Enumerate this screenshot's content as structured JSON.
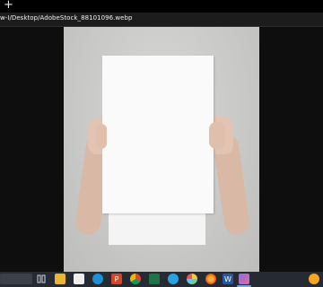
{
  "browser": {
    "new_tab_glyph": "+",
    "address": "w-I/Desktop/AdobeStock_88101096.webp"
  },
  "viewer": {
    "image_subject": "person holding blank white sheet of paper in front of face"
  },
  "taskbar": {
    "icons": [
      {
        "name": "task-view-icon"
      },
      {
        "name": "file-explorer-icon"
      },
      {
        "name": "calendar-app-icon"
      },
      {
        "name": "edge-browser-icon"
      },
      {
        "name": "powerpoint-icon"
      },
      {
        "name": "chrome-icon"
      },
      {
        "name": "excel-chart-icon"
      },
      {
        "name": "telegram-icon"
      },
      {
        "name": "pinwheel-app-icon"
      },
      {
        "name": "firefox-icon"
      },
      {
        "name": "word-icon"
      },
      {
        "name": "photos-app-icon"
      }
    ],
    "tray_icon": "weather-icon"
  }
}
